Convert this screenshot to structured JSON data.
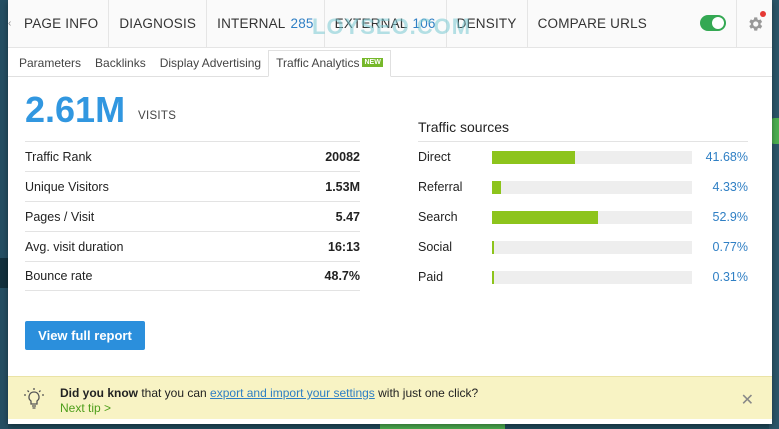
{
  "nav": {
    "tabs": [
      {
        "label": "PAGE INFO"
      },
      {
        "label": "DIAGNOSIS"
      },
      {
        "label": "INTERNAL",
        "count": "285"
      },
      {
        "label": "EXTERNAL",
        "count": "106"
      },
      {
        "label": "DENSITY"
      },
      {
        "label": "COMPARE URLS"
      }
    ],
    "watermark": "LOYSEO.COM"
  },
  "subtabs": [
    {
      "label": "Parameters"
    },
    {
      "label": "Backlinks"
    },
    {
      "label": "Display Advertising"
    },
    {
      "label": "Traffic Analytics",
      "badge": "NEW"
    }
  ],
  "visits": {
    "value": "2.61M",
    "label": "VISITS"
  },
  "stats": [
    {
      "label": "Traffic Rank",
      "value": "20082"
    },
    {
      "label": "Unique Visitors",
      "value": "1.53M"
    },
    {
      "label": "Pages / Visit",
      "value": "5.47"
    },
    {
      "label": "Avg. visit duration",
      "value": "16:13"
    },
    {
      "label": "Bounce rate",
      "value": "48.7%"
    }
  ],
  "sources": {
    "title": "Traffic sources",
    "items": [
      {
        "name": "Direct",
        "pct": "41.68%",
        "value": 41.68
      },
      {
        "name": "Referral",
        "pct": "4.33%",
        "value": 4.33
      },
      {
        "name": "Search",
        "pct": "52.9%",
        "value": 52.9
      },
      {
        "name": "Social",
        "pct": "0.77%",
        "value": 0.77
      },
      {
        "name": "Paid",
        "pct": "0.31%",
        "value": 0.31
      }
    ]
  },
  "report_button": "View full report",
  "tip": {
    "bold": "Did you know",
    "text1": " that you can ",
    "link": "export and import your settings",
    "text2": " with just one click?",
    "next": "Next tip >"
  },
  "colors": {
    "accent": "#3197e0",
    "bar": "#8dc41c",
    "toggle": "#34a853",
    "tip_bg": "#f8f3c4"
  }
}
